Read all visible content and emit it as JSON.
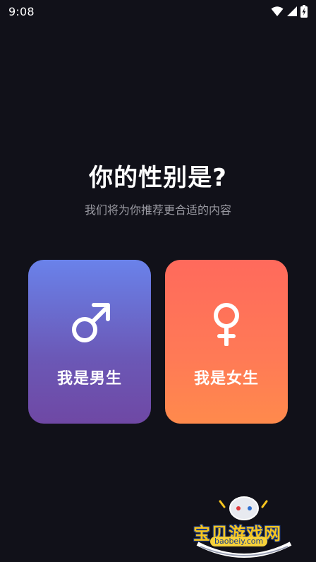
{
  "status_bar": {
    "time": "9:08",
    "icons": [
      "wifi-icon",
      "cellular-signal-icon",
      "battery-charging-icon"
    ]
  },
  "header": {
    "title": "你的性别是?",
    "subtitle": "我们将为你推荐更合适的内容"
  },
  "options": {
    "male": {
      "label": "我是男生",
      "icon": "male-symbol-icon",
      "colors": [
        "#6a82ea",
        "#6f48a4"
      ]
    },
    "female": {
      "label": "我是女生",
      "icon": "female-symbol-icon",
      "colors": [
        "#ff6a5c",
        "#ff8a4c"
      ]
    }
  },
  "watermark": {
    "text": "宝贝游戏网",
    "url": "baobeiy.com"
  },
  "colors": {
    "background": "#111119",
    "subtitle": "#9a9aa2"
  }
}
